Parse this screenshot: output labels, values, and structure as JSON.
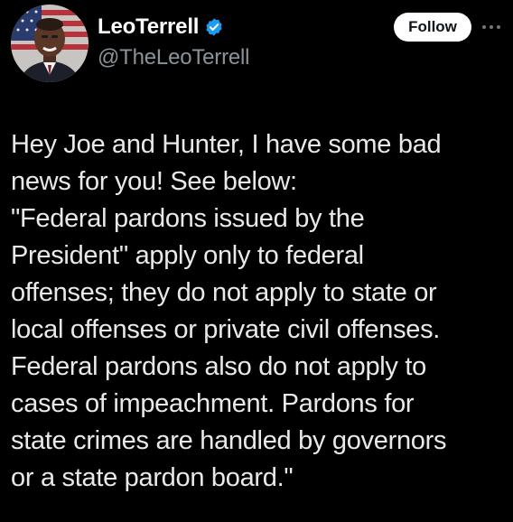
{
  "author": {
    "display_name": "LeoTerrell",
    "handle": "@TheLeoTerrell",
    "verified": true
  },
  "actions": {
    "follow_label": "Follow",
    "more_icon": "more-horizontal-icon"
  },
  "tweet": {
    "text": "Hey Joe and Hunter, I have some bad\nnews for you! See below:\n\"Federal pardons issued by the\nPresident\" apply only to federal\noffenses; they do not apply to state or\nlocal offenses or private civil offenses.\nFederal pardons also do not apply to\ncases of impeachment. Pardons for\nstate crimes are handled by governors\nor a state pardon board.\""
  },
  "colors": {
    "background": "#000000",
    "text": "#e7e9ea",
    "secondary_text": "#8b9399",
    "verified_badge": "#1d9bf0",
    "follow_button_bg": "#ffffff"
  }
}
